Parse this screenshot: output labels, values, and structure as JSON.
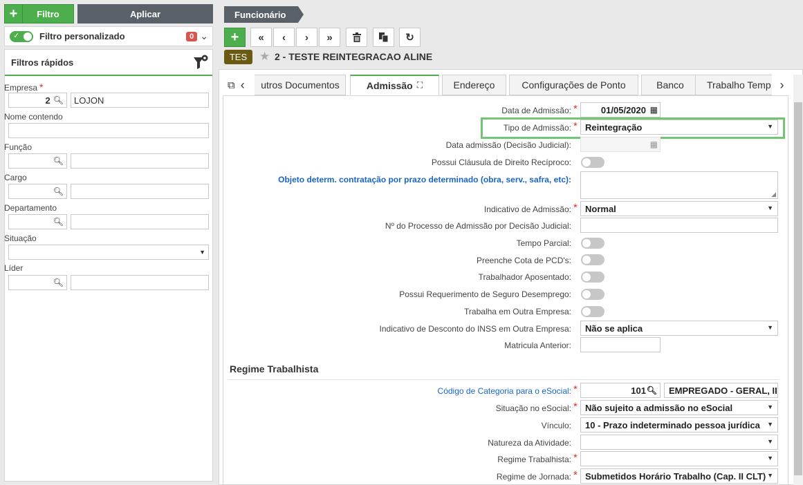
{
  "left": {
    "filter_button": "Filtro",
    "apply_button": "Aplicar",
    "custom_filter_label": "Filtro personalizado",
    "custom_filter_count": "0",
    "quick_filters_title": "Filtros rápidos",
    "empresa_label": "Empresa",
    "empresa_code": "2",
    "empresa_name": "LOJON",
    "nome_label": "Nome contendo",
    "funcao_label": "Função",
    "cargo_label": "Cargo",
    "departamento_label": "Departamento",
    "situacao_label": "Situação",
    "lider_label": "Líder"
  },
  "header": {
    "breadcrumb": "Funcionário",
    "badge": "TES",
    "record_title": "2 - TESTE REINTEGRACAO ALINE"
  },
  "tabs": [
    "utros Documentos",
    "Admissão",
    "Endereço",
    "Configurações de Ponto",
    "Banco",
    "Trabalho Temp"
  ],
  "form": {
    "data_admissao_label": "Data de Admissão:",
    "data_admissao_value": "01/05/2020",
    "tipo_admissao_label": "Tipo de Admissão:",
    "tipo_admissao_value": "Reintegração",
    "data_judicial_label": "Data admissão (Decisão Judicial):",
    "clausula_label": "Possui Cláusula de Direito Recíproco:",
    "objeto_label": "Objeto determ. contratação por prazo determinado (obra, serv., safra, etc):",
    "indicativo_label": "Indicativo de Admissão:",
    "indicativo_value": "Normal",
    "processo_label": "Nº do Processo de Admissão por Decisão Judicial:",
    "tempo_parcial_label": "Tempo Parcial:",
    "pcd_label": "Preenche Cota de PCD's:",
    "aposentado_label": "Trabalhador Aposentado:",
    "seguro_label": "Possui Requerimento de Seguro Desemprego:",
    "outra_empresa_label": "Trabalha em Outra Empresa:",
    "inss_label": "Indicativo de Desconto do INSS em Outra Empresa:",
    "inss_value": "Não se aplica",
    "matricula_label": "Matricula Anterior:"
  },
  "regime": {
    "section_title": "Regime Trabalhista",
    "categoria_label": "Código de Categoria para o eSocial:",
    "categoria_code": "101",
    "categoria_name": "EMPREGADO - GERAL, II",
    "situacao_label": "Situação no eSocial:",
    "situacao_value": "Não sujeito a admissão no eSocial",
    "vinculo_label": "Vínculo:",
    "vinculo_value": "10 - Prazo indeterminado pessoa jurídica",
    "natureza_label": "Natureza da Atividade:",
    "regime_label": "Regime Trabalhista:",
    "jornada_label": "Regime de Jornada:",
    "jornada_value": "Submetidos Horário Trabalho (Cap. II CLT)"
  }
}
